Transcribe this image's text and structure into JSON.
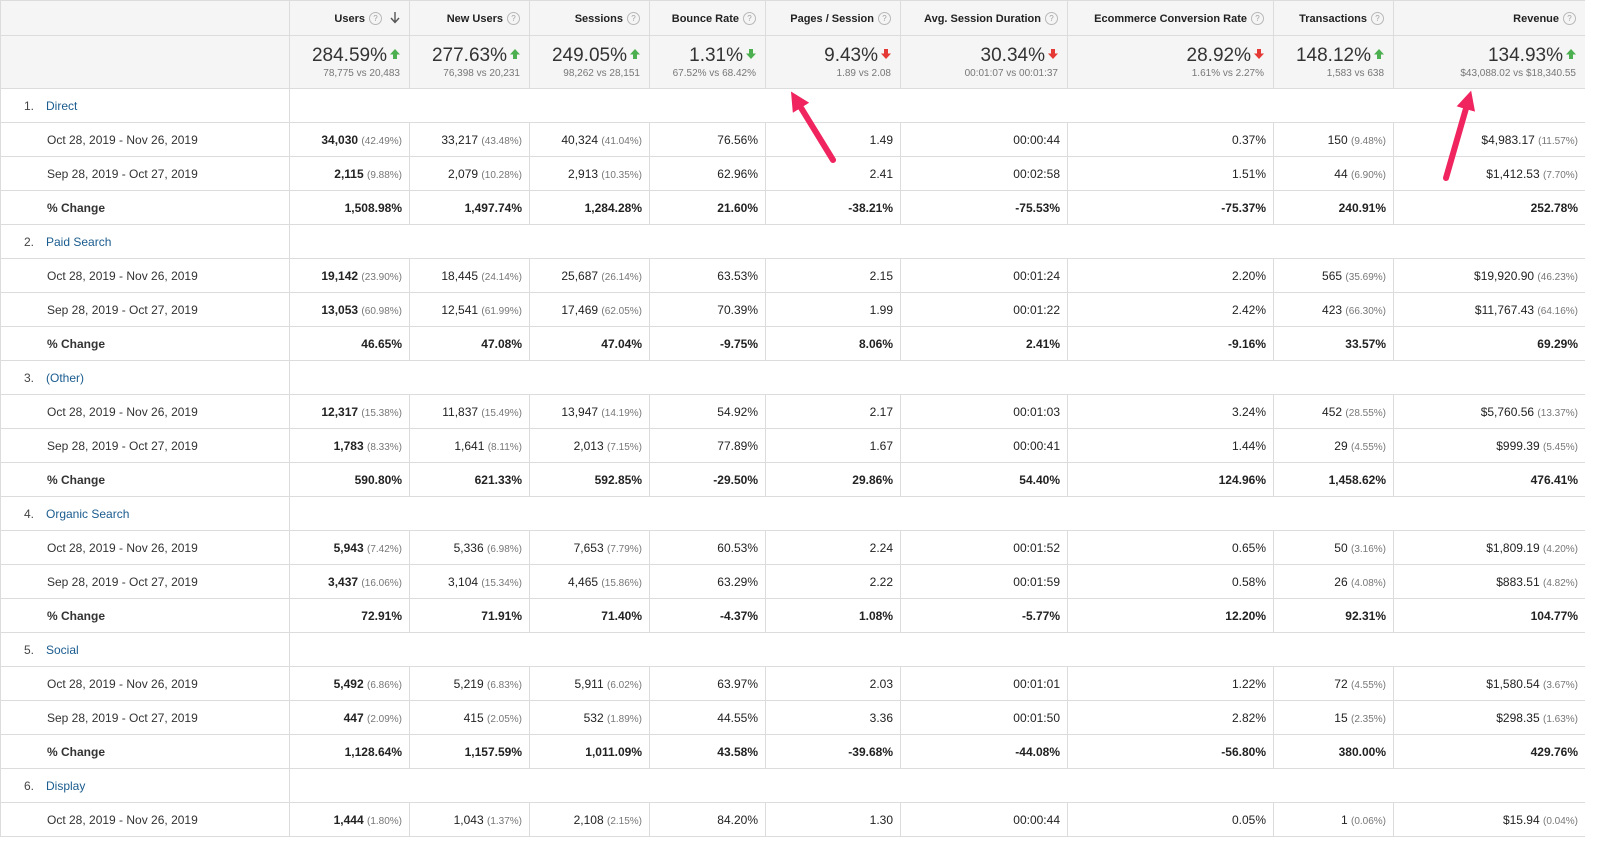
{
  "columns": [
    {
      "key": "users",
      "label": "Users",
      "sorted": true
    },
    {
      "key": "new_users",
      "label": "New Users"
    },
    {
      "key": "sessions",
      "label": "Sessions"
    },
    {
      "key": "bounce",
      "label": "Bounce Rate"
    },
    {
      "key": "pps",
      "label": "Pages / Session"
    },
    {
      "key": "asd",
      "label": "Avg. Session Duration"
    },
    {
      "key": "ecr",
      "label": "Ecommerce Conversion Rate"
    },
    {
      "key": "trans",
      "label": "Transactions"
    },
    {
      "key": "rev",
      "label": "Revenue"
    }
  ],
  "help_glyph": "?",
  "summary": [
    {
      "value": "284.59%",
      "sub": "78,775 vs 20,483",
      "dir": "up"
    },
    {
      "value": "277.63%",
      "sub": "76,398 vs 20,231",
      "dir": "up"
    },
    {
      "value": "249.05%",
      "sub": "98,262 vs 28,151",
      "dir": "up"
    },
    {
      "value": "1.31%",
      "sub": "67.52% vs 68.42%",
      "dir": "down-good"
    },
    {
      "value": "9.43%",
      "sub": "1.89 vs 2.08",
      "dir": "down"
    },
    {
      "value": "30.34%",
      "sub": "00:01:07 vs 00:01:37",
      "dir": "down"
    },
    {
      "value": "28.92%",
      "sub": "1.61% vs 2.27%",
      "dir": "down"
    },
    {
      "value": "148.12%",
      "sub": "1,583 vs 638",
      "dir": "up"
    },
    {
      "value": "134.93%",
      "sub": "$43,088.02 vs $18,340.55",
      "dir": "up"
    }
  ],
  "colors": {
    "up": "#4caf50",
    "down": "#e53935",
    "link": "#1a5c8f",
    "annotation": "#f0245e"
  },
  "groups": [
    {
      "num": "1.",
      "name": "Direct",
      "rows": [
        {
          "label": "Oct 28, 2019 - Nov 26, 2019",
          "cells": [
            [
              "34,030",
              "(42.49%)"
            ],
            [
              "33,217",
              "(43.48%)"
            ],
            [
              "40,324",
              "(41.04%)"
            ],
            [
              "76.56%",
              ""
            ],
            [
              "1.49",
              ""
            ],
            [
              "00:00:44",
              ""
            ],
            [
              "0.37%",
              ""
            ],
            [
              "150",
              "(9.48%)"
            ],
            [
              "$4,983.17",
              "(11.57%)"
            ]
          ]
        },
        {
          "label": "Sep 28, 2019 - Oct 27, 2019",
          "cells": [
            [
              "2,115",
              "(9.88%)"
            ],
            [
              "2,079",
              "(10.28%)"
            ],
            [
              "2,913",
              "(10.35%)"
            ],
            [
              "62.96%",
              ""
            ],
            [
              "2.41",
              ""
            ],
            [
              "00:02:58",
              ""
            ],
            [
              "1.51%",
              ""
            ],
            [
              "44",
              "(6.90%)"
            ],
            [
              "$1,412.53",
              "(7.70%)"
            ]
          ]
        },
        {
          "label": "% Change",
          "change": true,
          "cells": [
            [
              "1,508.98%",
              ""
            ],
            [
              "1,497.74%",
              ""
            ],
            [
              "1,284.28%",
              ""
            ],
            [
              "21.60%",
              ""
            ],
            [
              "-38.21%",
              ""
            ],
            [
              "-75.53%",
              ""
            ],
            [
              "-75.37%",
              ""
            ],
            [
              "240.91%",
              ""
            ],
            [
              "252.78%",
              ""
            ]
          ]
        }
      ]
    },
    {
      "num": "2.",
      "name": "Paid Search",
      "rows": [
        {
          "label": "Oct 28, 2019 - Nov 26, 2019",
          "cells": [
            [
              "19,142",
              "(23.90%)"
            ],
            [
              "18,445",
              "(24.14%)"
            ],
            [
              "25,687",
              "(26.14%)"
            ],
            [
              "63.53%",
              ""
            ],
            [
              "2.15",
              ""
            ],
            [
              "00:01:24",
              ""
            ],
            [
              "2.20%",
              ""
            ],
            [
              "565",
              "(35.69%)"
            ],
            [
              "$19,920.90",
              "(46.23%)"
            ]
          ]
        },
        {
          "label": "Sep 28, 2019 - Oct 27, 2019",
          "cells": [
            [
              "13,053",
              "(60.98%)"
            ],
            [
              "12,541",
              "(61.99%)"
            ],
            [
              "17,469",
              "(62.05%)"
            ],
            [
              "70.39%",
              ""
            ],
            [
              "1.99",
              ""
            ],
            [
              "00:01:22",
              ""
            ],
            [
              "2.42%",
              ""
            ],
            [
              "423",
              "(66.30%)"
            ],
            [
              "$11,767.43",
              "(64.16%)"
            ]
          ]
        },
        {
          "label": "% Change",
          "change": true,
          "cells": [
            [
              "46.65%",
              ""
            ],
            [
              "47.08%",
              ""
            ],
            [
              "47.04%",
              ""
            ],
            [
              "-9.75%",
              ""
            ],
            [
              "8.06%",
              ""
            ],
            [
              "2.41%",
              ""
            ],
            [
              "-9.16%",
              ""
            ],
            [
              "33.57%",
              ""
            ],
            [
              "69.29%",
              ""
            ]
          ]
        }
      ]
    },
    {
      "num": "3.",
      "name": "(Other)",
      "rows": [
        {
          "label": "Oct 28, 2019 - Nov 26, 2019",
          "cells": [
            [
              "12,317",
              "(15.38%)"
            ],
            [
              "11,837",
              "(15.49%)"
            ],
            [
              "13,947",
              "(14.19%)"
            ],
            [
              "54.92%",
              ""
            ],
            [
              "2.17",
              ""
            ],
            [
              "00:01:03",
              ""
            ],
            [
              "3.24%",
              ""
            ],
            [
              "452",
              "(28.55%)"
            ],
            [
              "$5,760.56",
              "(13.37%)"
            ]
          ]
        },
        {
          "label": "Sep 28, 2019 - Oct 27, 2019",
          "cells": [
            [
              "1,783",
              "(8.33%)"
            ],
            [
              "1,641",
              "(8.11%)"
            ],
            [
              "2,013",
              "(7.15%)"
            ],
            [
              "77.89%",
              ""
            ],
            [
              "1.67",
              ""
            ],
            [
              "00:00:41",
              ""
            ],
            [
              "1.44%",
              ""
            ],
            [
              "29",
              "(4.55%)"
            ],
            [
              "$999.39",
              "(5.45%)"
            ]
          ]
        },
        {
          "label": "% Change",
          "change": true,
          "cells": [
            [
              "590.80%",
              ""
            ],
            [
              "621.33%",
              ""
            ],
            [
              "592.85%",
              ""
            ],
            [
              "-29.50%",
              ""
            ],
            [
              "29.86%",
              ""
            ],
            [
              "54.40%",
              ""
            ],
            [
              "124.96%",
              ""
            ],
            [
              "1,458.62%",
              ""
            ],
            [
              "476.41%",
              ""
            ]
          ]
        }
      ]
    },
    {
      "num": "4.",
      "name": "Organic Search",
      "rows": [
        {
          "label": "Oct 28, 2019 - Nov 26, 2019",
          "cells": [
            [
              "5,943",
              "(7.42%)"
            ],
            [
              "5,336",
              "(6.98%)"
            ],
            [
              "7,653",
              "(7.79%)"
            ],
            [
              "60.53%",
              ""
            ],
            [
              "2.24",
              ""
            ],
            [
              "00:01:52",
              ""
            ],
            [
              "0.65%",
              ""
            ],
            [
              "50",
              "(3.16%)"
            ],
            [
              "$1,809.19",
              "(4.20%)"
            ]
          ]
        },
        {
          "label": "Sep 28, 2019 - Oct 27, 2019",
          "cells": [
            [
              "3,437",
              "(16.06%)"
            ],
            [
              "3,104",
              "(15.34%)"
            ],
            [
              "4,465",
              "(15.86%)"
            ],
            [
              "63.29%",
              ""
            ],
            [
              "2.22",
              ""
            ],
            [
              "00:01:59",
              ""
            ],
            [
              "0.58%",
              ""
            ],
            [
              "26",
              "(4.08%)"
            ],
            [
              "$883.51",
              "(4.82%)"
            ]
          ]
        },
        {
          "label": "% Change",
          "change": true,
          "cells": [
            [
              "72.91%",
              ""
            ],
            [
              "71.91%",
              ""
            ],
            [
              "71.40%",
              ""
            ],
            [
              "-4.37%",
              ""
            ],
            [
              "1.08%",
              ""
            ],
            [
              "-5.77%",
              ""
            ],
            [
              "12.20%",
              ""
            ],
            [
              "92.31%",
              ""
            ],
            [
              "104.77%",
              ""
            ]
          ]
        }
      ]
    },
    {
      "num": "5.",
      "name": "Social",
      "rows": [
        {
          "label": "Oct 28, 2019 - Nov 26, 2019",
          "cells": [
            [
              "5,492",
              "(6.86%)"
            ],
            [
              "5,219",
              "(6.83%)"
            ],
            [
              "5,911",
              "(6.02%)"
            ],
            [
              "63.97%",
              ""
            ],
            [
              "2.03",
              ""
            ],
            [
              "00:01:01",
              ""
            ],
            [
              "1.22%",
              ""
            ],
            [
              "72",
              "(4.55%)"
            ],
            [
              "$1,580.54",
              "(3.67%)"
            ]
          ]
        },
        {
          "label": "Sep 28, 2019 - Oct 27, 2019",
          "cells": [
            [
              "447",
              "(2.09%)"
            ],
            [
              "415",
              "(2.05%)"
            ],
            [
              "532",
              "(1.89%)"
            ],
            [
              "44.55%",
              ""
            ],
            [
              "3.36",
              ""
            ],
            [
              "00:01:50",
              ""
            ],
            [
              "2.82%",
              ""
            ],
            [
              "15",
              "(2.35%)"
            ],
            [
              "$298.35",
              "(1.63%)"
            ]
          ]
        },
        {
          "label": "% Change",
          "change": true,
          "cells": [
            [
              "1,128.64%",
              ""
            ],
            [
              "1,157.59%",
              ""
            ],
            [
              "1,011.09%",
              ""
            ],
            [
              "43.58%",
              ""
            ],
            [
              "-39.68%",
              ""
            ],
            [
              "-44.08%",
              ""
            ],
            [
              "-56.80%",
              ""
            ],
            [
              "380.00%",
              ""
            ],
            [
              "429.76%",
              ""
            ]
          ]
        }
      ]
    },
    {
      "num": "6.",
      "name": "Display",
      "rows": [
        {
          "label": "Oct 28, 2019 - Nov 26, 2019",
          "cells": [
            [
              "1,444",
              "(1.80%)"
            ],
            [
              "1,043",
              "(1.37%)"
            ],
            [
              "2,108",
              "(2.15%)"
            ],
            [
              "84.20%",
              ""
            ],
            [
              "1.30",
              ""
            ],
            [
              "00:00:44",
              ""
            ],
            [
              "0.05%",
              ""
            ],
            [
              "1",
              "(0.06%)"
            ],
            [
              "$15.94",
              "(0.04%)"
            ]
          ]
        }
      ]
    }
  ]
}
